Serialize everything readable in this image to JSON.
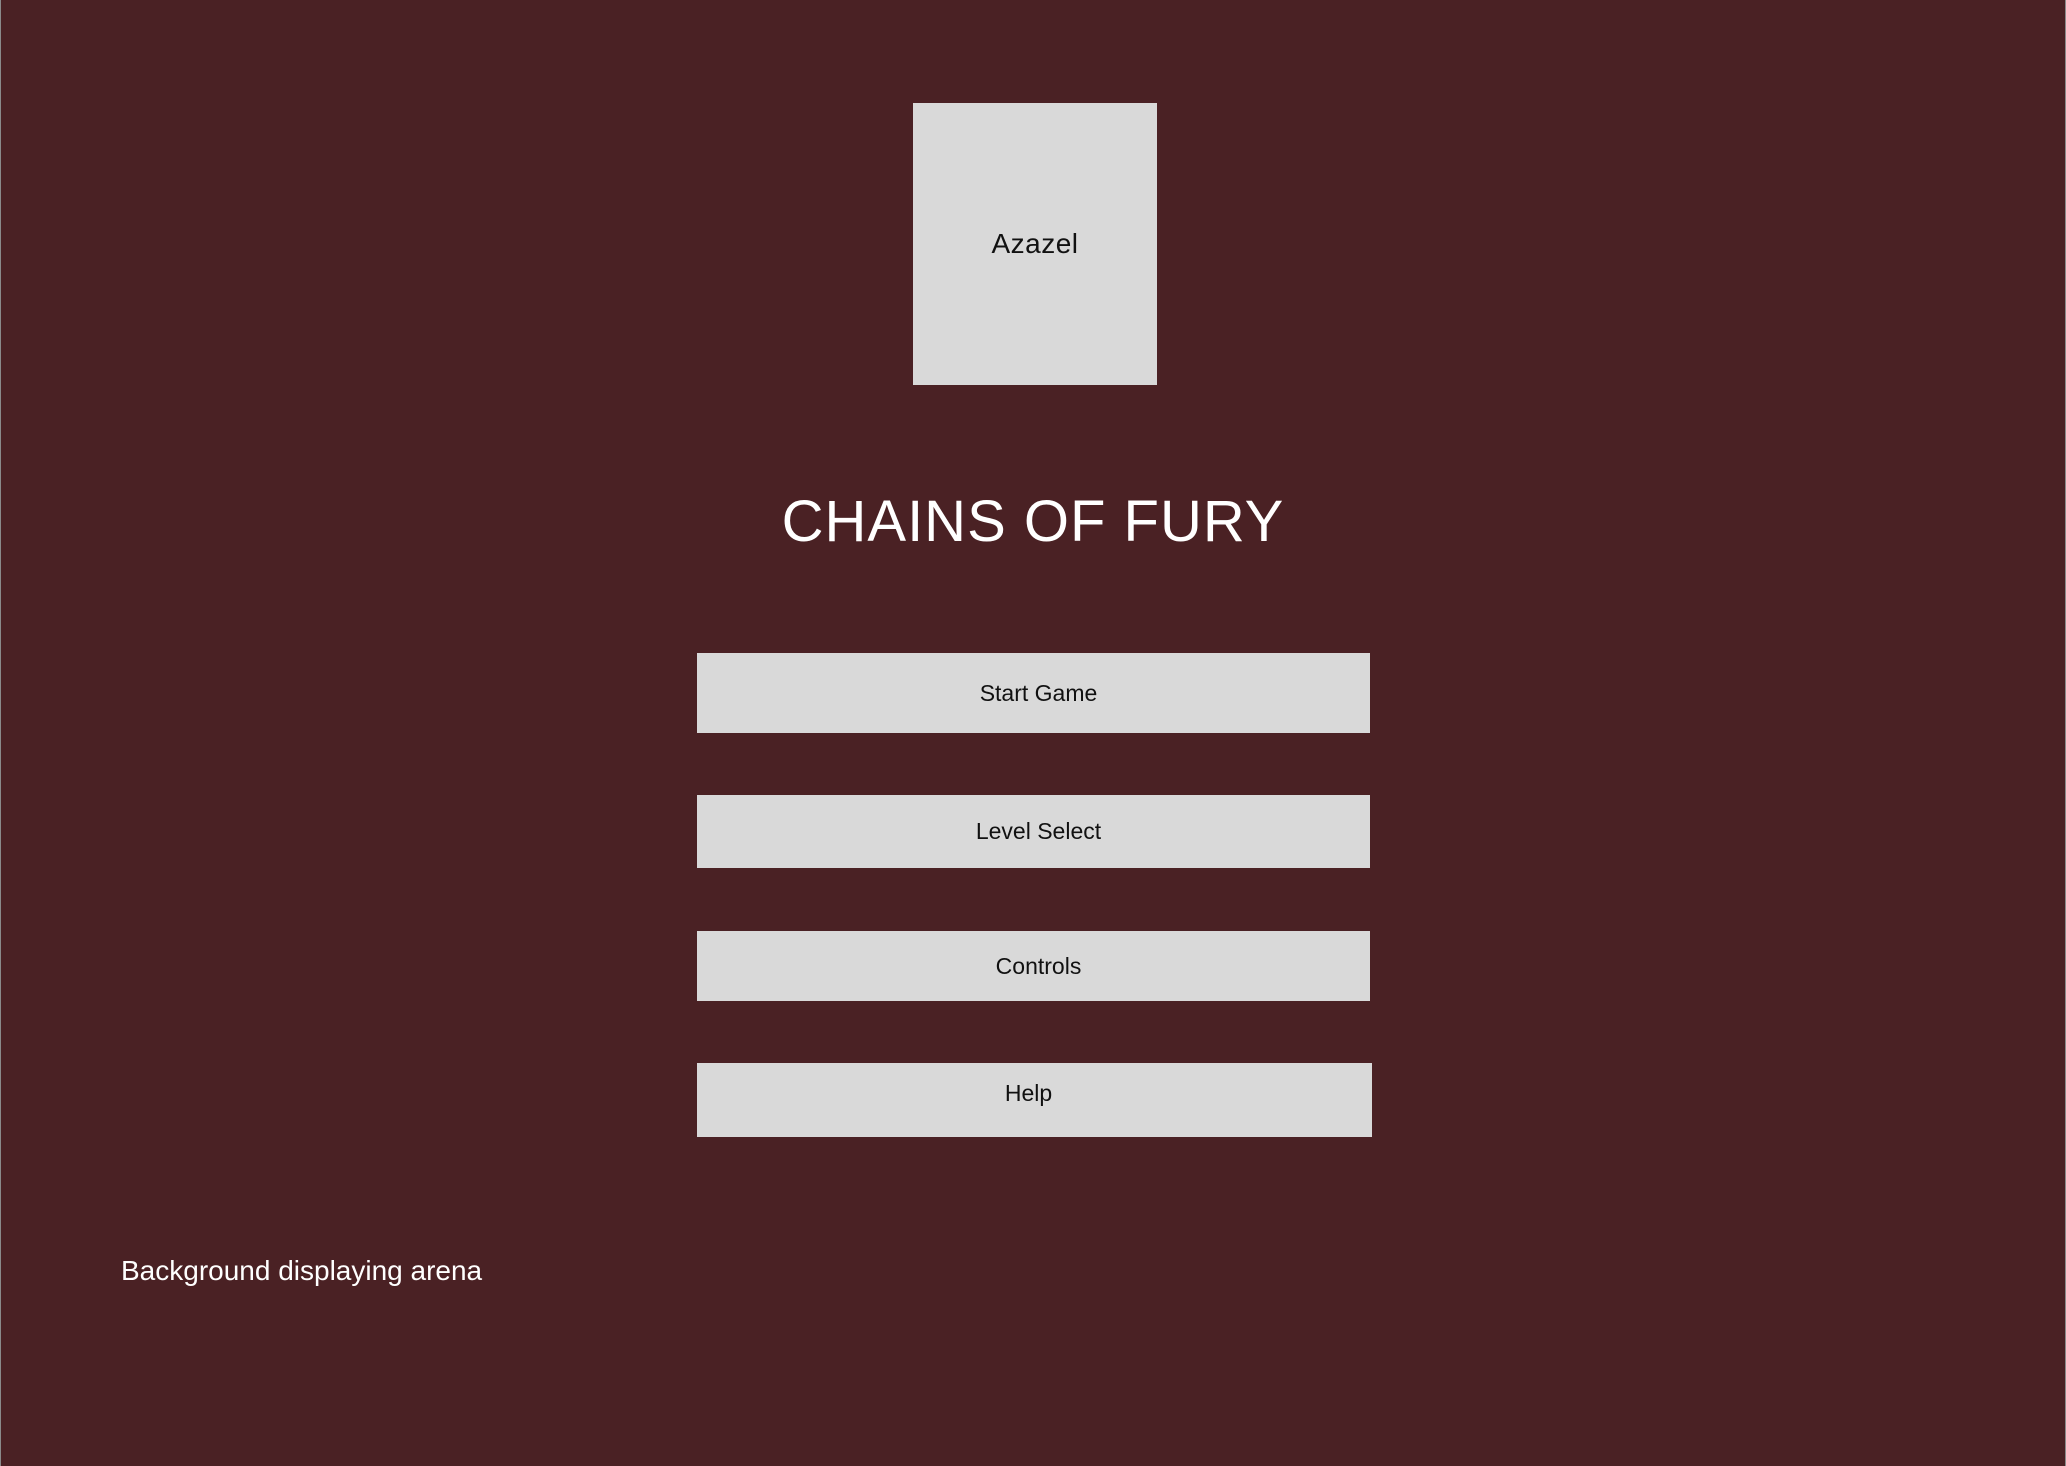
{
  "portrait": {
    "label": "Azazel"
  },
  "title": "CHAINS OF FURY",
  "menu": {
    "start_label": "Start Game",
    "level_select_label": "Level Select",
    "controls_label": "Controls",
    "help_label": "Help"
  },
  "background_note": "Background displaying arena",
  "colors": {
    "background": "#4a2124",
    "button": "#d9d9d9",
    "title_text": "#ffffff",
    "button_text": "#111111"
  }
}
